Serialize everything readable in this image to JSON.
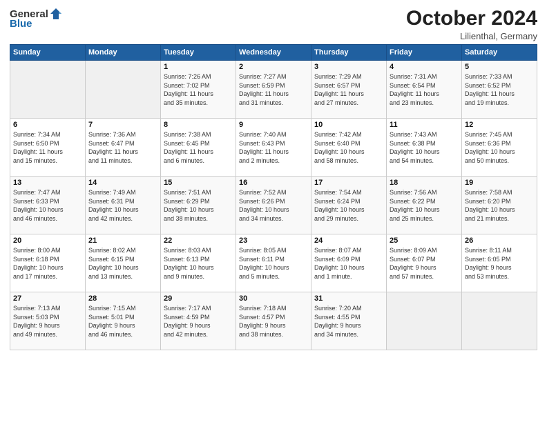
{
  "header": {
    "logo_general": "General",
    "logo_blue": "Blue",
    "month_title": "October 2024",
    "subtitle": "Lilienthal, Germany"
  },
  "weekdays": [
    "Sunday",
    "Monday",
    "Tuesday",
    "Wednesday",
    "Thursday",
    "Friday",
    "Saturday"
  ],
  "weeks": [
    [
      {
        "day": "",
        "info": ""
      },
      {
        "day": "",
        "info": ""
      },
      {
        "day": "1",
        "info": "Sunrise: 7:26 AM\nSunset: 7:02 PM\nDaylight: 11 hours\nand 35 minutes."
      },
      {
        "day": "2",
        "info": "Sunrise: 7:27 AM\nSunset: 6:59 PM\nDaylight: 11 hours\nand 31 minutes."
      },
      {
        "day": "3",
        "info": "Sunrise: 7:29 AM\nSunset: 6:57 PM\nDaylight: 11 hours\nand 27 minutes."
      },
      {
        "day": "4",
        "info": "Sunrise: 7:31 AM\nSunset: 6:54 PM\nDaylight: 11 hours\nand 23 minutes."
      },
      {
        "day": "5",
        "info": "Sunrise: 7:33 AM\nSunset: 6:52 PM\nDaylight: 11 hours\nand 19 minutes."
      }
    ],
    [
      {
        "day": "6",
        "info": "Sunrise: 7:34 AM\nSunset: 6:50 PM\nDaylight: 11 hours\nand 15 minutes."
      },
      {
        "day": "7",
        "info": "Sunrise: 7:36 AM\nSunset: 6:47 PM\nDaylight: 11 hours\nand 11 minutes."
      },
      {
        "day": "8",
        "info": "Sunrise: 7:38 AM\nSunset: 6:45 PM\nDaylight: 11 hours\nand 6 minutes."
      },
      {
        "day": "9",
        "info": "Sunrise: 7:40 AM\nSunset: 6:43 PM\nDaylight: 11 hours\nand 2 minutes."
      },
      {
        "day": "10",
        "info": "Sunrise: 7:42 AM\nSunset: 6:40 PM\nDaylight: 10 hours\nand 58 minutes."
      },
      {
        "day": "11",
        "info": "Sunrise: 7:43 AM\nSunset: 6:38 PM\nDaylight: 10 hours\nand 54 minutes."
      },
      {
        "day": "12",
        "info": "Sunrise: 7:45 AM\nSunset: 6:36 PM\nDaylight: 10 hours\nand 50 minutes."
      }
    ],
    [
      {
        "day": "13",
        "info": "Sunrise: 7:47 AM\nSunset: 6:33 PM\nDaylight: 10 hours\nand 46 minutes."
      },
      {
        "day": "14",
        "info": "Sunrise: 7:49 AM\nSunset: 6:31 PM\nDaylight: 10 hours\nand 42 minutes."
      },
      {
        "day": "15",
        "info": "Sunrise: 7:51 AM\nSunset: 6:29 PM\nDaylight: 10 hours\nand 38 minutes."
      },
      {
        "day": "16",
        "info": "Sunrise: 7:52 AM\nSunset: 6:26 PM\nDaylight: 10 hours\nand 34 minutes."
      },
      {
        "day": "17",
        "info": "Sunrise: 7:54 AM\nSunset: 6:24 PM\nDaylight: 10 hours\nand 29 minutes."
      },
      {
        "day": "18",
        "info": "Sunrise: 7:56 AM\nSunset: 6:22 PM\nDaylight: 10 hours\nand 25 minutes."
      },
      {
        "day": "19",
        "info": "Sunrise: 7:58 AM\nSunset: 6:20 PM\nDaylight: 10 hours\nand 21 minutes."
      }
    ],
    [
      {
        "day": "20",
        "info": "Sunrise: 8:00 AM\nSunset: 6:18 PM\nDaylight: 10 hours\nand 17 minutes."
      },
      {
        "day": "21",
        "info": "Sunrise: 8:02 AM\nSunset: 6:15 PM\nDaylight: 10 hours\nand 13 minutes."
      },
      {
        "day": "22",
        "info": "Sunrise: 8:03 AM\nSunset: 6:13 PM\nDaylight: 10 hours\nand 9 minutes."
      },
      {
        "day": "23",
        "info": "Sunrise: 8:05 AM\nSunset: 6:11 PM\nDaylight: 10 hours\nand 5 minutes."
      },
      {
        "day": "24",
        "info": "Sunrise: 8:07 AM\nSunset: 6:09 PM\nDaylight: 10 hours\nand 1 minute."
      },
      {
        "day": "25",
        "info": "Sunrise: 8:09 AM\nSunset: 6:07 PM\nDaylight: 9 hours\nand 57 minutes."
      },
      {
        "day": "26",
        "info": "Sunrise: 8:11 AM\nSunset: 6:05 PM\nDaylight: 9 hours\nand 53 minutes."
      }
    ],
    [
      {
        "day": "27",
        "info": "Sunrise: 7:13 AM\nSunset: 5:03 PM\nDaylight: 9 hours\nand 49 minutes."
      },
      {
        "day": "28",
        "info": "Sunrise: 7:15 AM\nSunset: 5:01 PM\nDaylight: 9 hours\nand 46 minutes."
      },
      {
        "day": "29",
        "info": "Sunrise: 7:17 AM\nSunset: 4:59 PM\nDaylight: 9 hours\nand 42 minutes."
      },
      {
        "day": "30",
        "info": "Sunrise: 7:18 AM\nSunset: 4:57 PM\nDaylight: 9 hours\nand 38 minutes."
      },
      {
        "day": "31",
        "info": "Sunrise: 7:20 AM\nSunset: 4:55 PM\nDaylight: 9 hours\nand 34 minutes."
      },
      {
        "day": "",
        "info": ""
      },
      {
        "day": "",
        "info": ""
      }
    ]
  ]
}
